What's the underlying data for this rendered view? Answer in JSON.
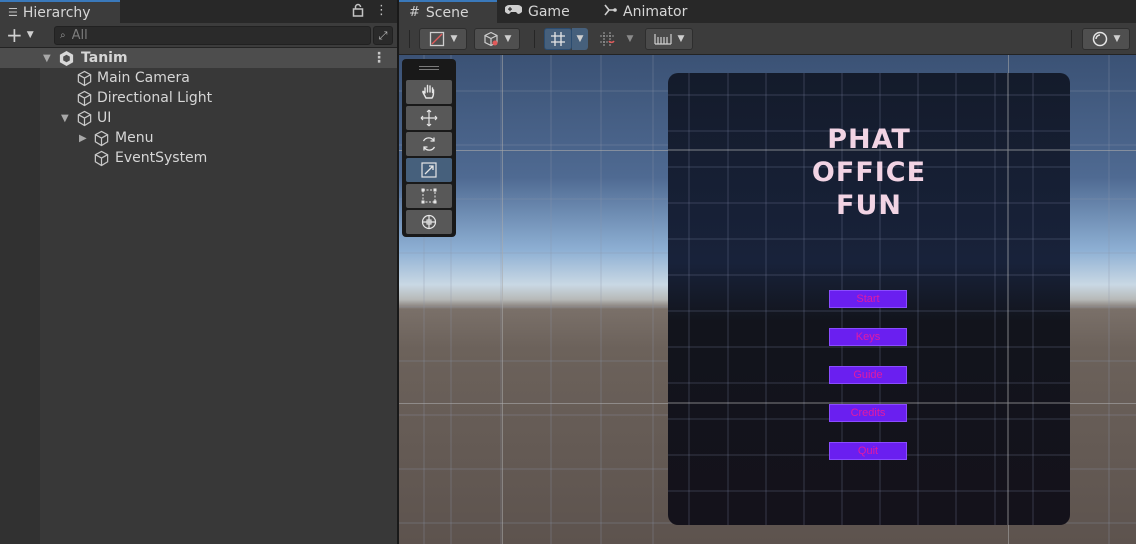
{
  "hierarchy": {
    "tab_label": "Hierarchy",
    "search": {
      "placeholder": "All",
      "value": ""
    },
    "scene": {
      "name": "Tanim"
    },
    "items": [
      {
        "label": "Main Camera",
        "depth": 1,
        "expandable": false
      },
      {
        "label": "Directional Light",
        "depth": 1,
        "expandable": false
      },
      {
        "label": "UI",
        "depth": 1,
        "expandable": true,
        "expanded": true
      },
      {
        "label": "Menu",
        "depth": 2,
        "expandable": true,
        "expanded": false
      },
      {
        "label": "EventSystem",
        "depth": 2,
        "expandable": false
      }
    ]
  },
  "scene_view": {
    "tabs": [
      {
        "label": "Scene",
        "icon": "hash-icon",
        "active": true
      },
      {
        "label": "Game",
        "icon": "gamepad-icon",
        "active": false
      },
      {
        "label": "Animator",
        "icon": "animator-icon",
        "active": false
      }
    ],
    "tools": [
      {
        "name": "hand-tool",
        "active": false
      },
      {
        "name": "move-tool",
        "active": false
      },
      {
        "name": "rotate-tool",
        "active": false
      },
      {
        "name": "scale-tool",
        "active": true
      },
      {
        "name": "rect-tool",
        "active": false
      },
      {
        "name": "transform-tool",
        "active": false
      }
    ],
    "game_ui": {
      "title": "PHAT\nOFFICE\nFUN",
      "buttons": [
        "Start",
        "Keys",
        "Guide",
        "Credits",
        "Quit"
      ]
    }
  },
  "colors": {
    "accent_tab": "#3a79bb",
    "active_tool": "#46607c",
    "menu_button_bg": "#6a1ff0",
    "menu_button_text": "#e01aa3",
    "title_text": "#f2d4e4"
  }
}
